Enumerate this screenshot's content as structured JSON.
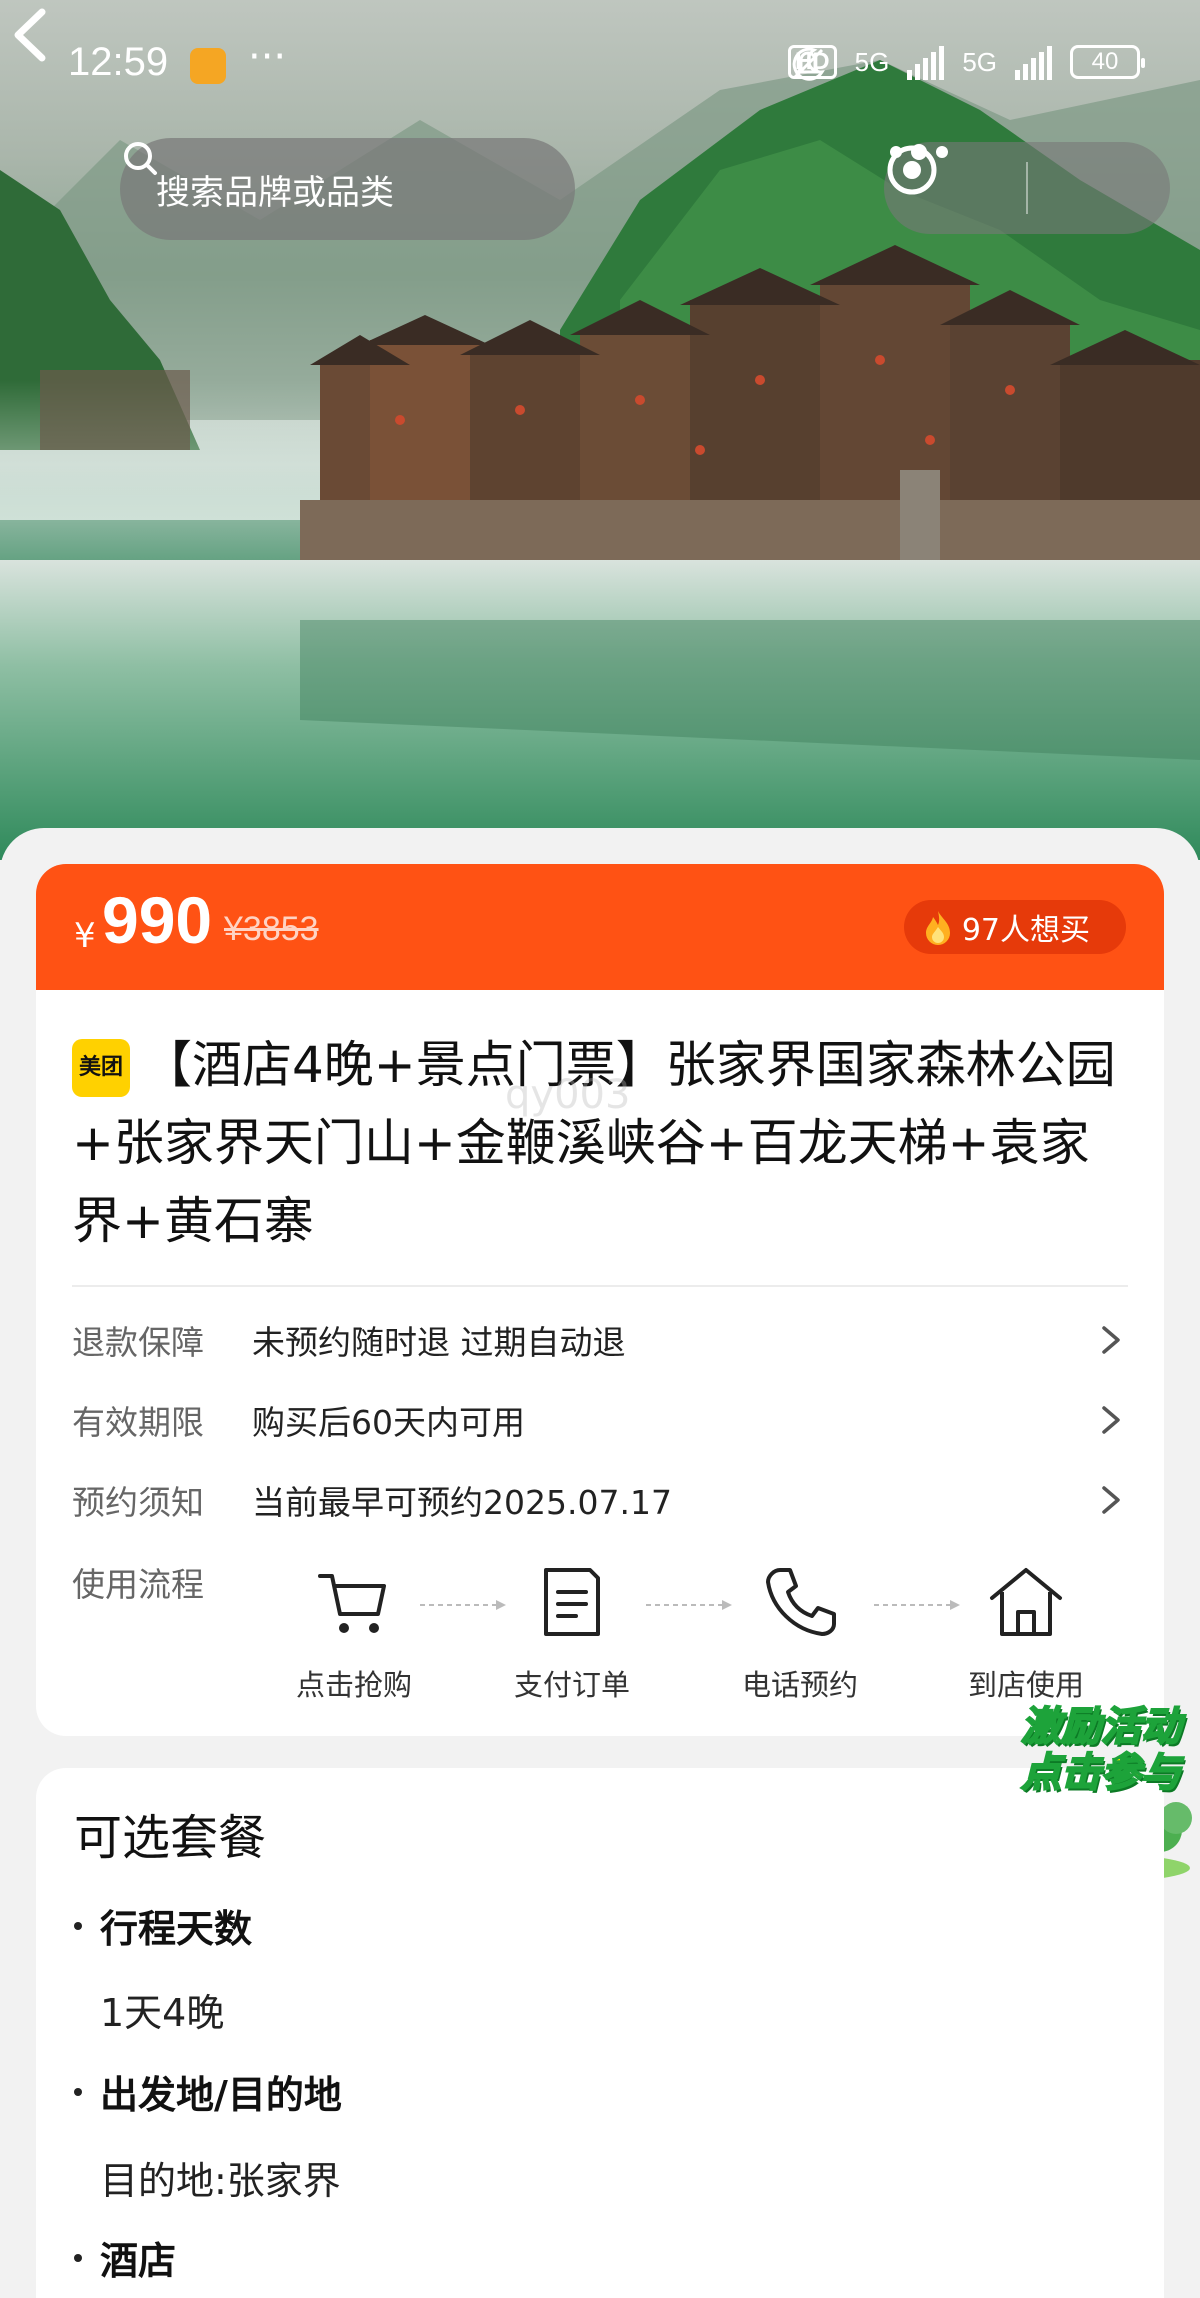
{
  "status_bar": {
    "time": "12:59",
    "more": "···",
    "network_badge": "HD",
    "signal_a": "5G",
    "signal_b": "5G",
    "battery": "40"
  },
  "nav": {
    "search_placeholder": "搜索品牌或品类"
  },
  "price": {
    "currency": "¥",
    "current": "990",
    "original": "¥3853",
    "want_count": "97人想买"
  },
  "product": {
    "brand": "美团",
    "title": "【酒店4晚+景点门票】张家界国家森林公园+张家界天门山+金鞭溪峡谷+百龙天梯+袁家界+黄石寨",
    "watermark": "qy003"
  },
  "info_rows": [
    {
      "label": "退款保障",
      "value": "未预约随时退 过期自动退"
    },
    {
      "label": "有效期限",
      "value": "购买后60天内可用"
    },
    {
      "label": "预约须知",
      "value": "当前最早可预约2025.07.17"
    }
  ],
  "flow": {
    "label": "使用流程",
    "steps": [
      {
        "label": "点击抢购",
        "icon": "cart-icon"
      },
      {
        "label": "支付订单",
        "icon": "order-icon"
      },
      {
        "label": "电话预约",
        "icon": "phone-icon"
      },
      {
        "label": "到店使用",
        "icon": "home-icon"
      }
    ]
  },
  "packages": {
    "title": "可选套餐",
    "specs": [
      {
        "name": "行程天数",
        "value": "1天4晚"
      },
      {
        "name": "出发地/目的地",
        "value": "目的地:张家界"
      },
      {
        "name": "酒店",
        "value": ""
      }
    ]
  },
  "promo": {
    "line1": "激励活动",
    "line2": "点击参与"
  },
  "colors": {
    "accent": "#ff5214",
    "brand_yellow": "#ffd100"
  }
}
